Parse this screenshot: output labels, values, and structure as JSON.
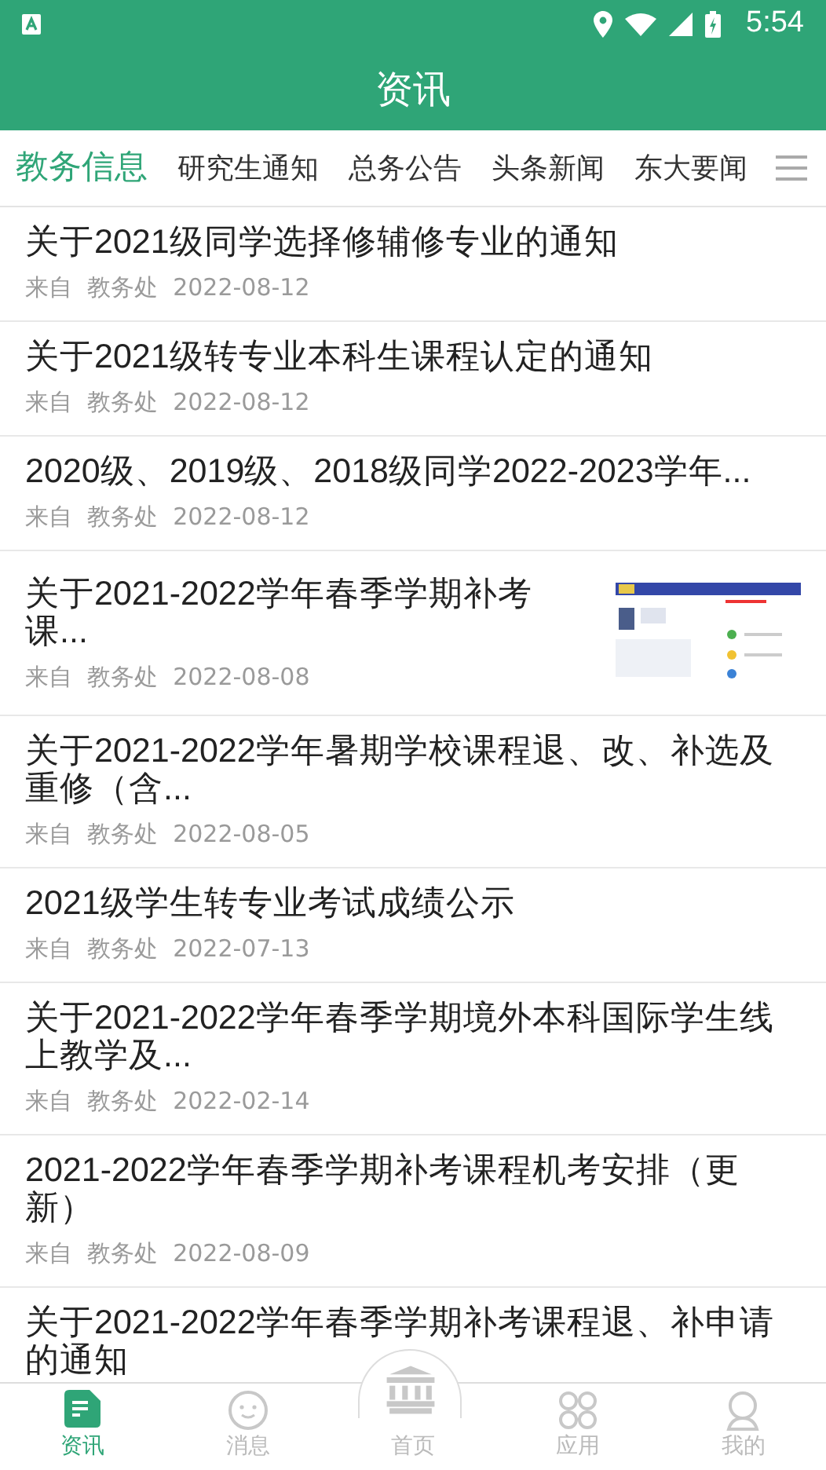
{
  "status_bar": {
    "time": "5:54"
  },
  "header": {
    "title": "资讯"
  },
  "tabs": [
    {
      "label": "教务信息",
      "selected": true
    },
    {
      "label": "研究生通知",
      "selected": false
    },
    {
      "label": "总务公告",
      "selected": false
    },
    {
      "label": "头条新闻",
      "selected": false
    },
    {
      "label": "东大要闻",
      "selected": false
    }
  ],
  "news": [
    {
      "title": "关于2021级同学选择修辅修专业的通知",
      "source_prefix": "来自",
      "source": "教务处",
      "date": "2022-08-12"
    },
    {
      "title": "关于2021级转专业本科生课程认定的通知",
      "source_prefix": "来自",
      "source": "教务处",
      "date": "2022-08-12"
    },
    {
      "title": "2020级、2019级、2018级同学2022-2023学年...",
      "source_prefix": "来自",
      "source": "教务处",
      "date": "2022-08-12"
    },
    {
      "title": "关于2021-2022学年春季学期补考课...",
      "source_prefix": "来自",
      "source": "教务处",
      "date": "2022-08-08"
    },
    {
      "title": "关于2021-2022学年暑期学校课程退、改、补选及重修（含...",
      "source_prefix": "来自",
      "source": "教务处",
      "date": "2022-08-05"
    },
    {
      "title": "2021级学生转专业考试成绩公示",
      "source_prefix": "来自",
      "source": "教务处",
      "date": "2022-07-13"
    },
    {
      "title": "关于2021-2022学年春季学期境外本科国际学生线上教学及...",
      "source_prefix": "来自",
      "source": "教务处",
      "date": "2022-02-14"
    },
    {
      "title": "2021-2022学年春季学期补考课程机考安排（更新）",
      "source_prefix": "来自",
      "source": "教务处",
      "date": "2022-08-09"
    },
    {
      "title": "关于2021-2022学年春季学期补考课程退、补申请的通知"
    }
  ],
  "bottom_nav": [
    {
      "label": "资讯",
      "selected": true
    },
    {
      "label": "消息",
      "selected": false
    },
    {
      "label": "首页",
      "selected": false
    },
    {
      "label": "应用",
      "selected": false
    },
    {
      "label": "我的",
      "selected": false
    }
  ]
}
